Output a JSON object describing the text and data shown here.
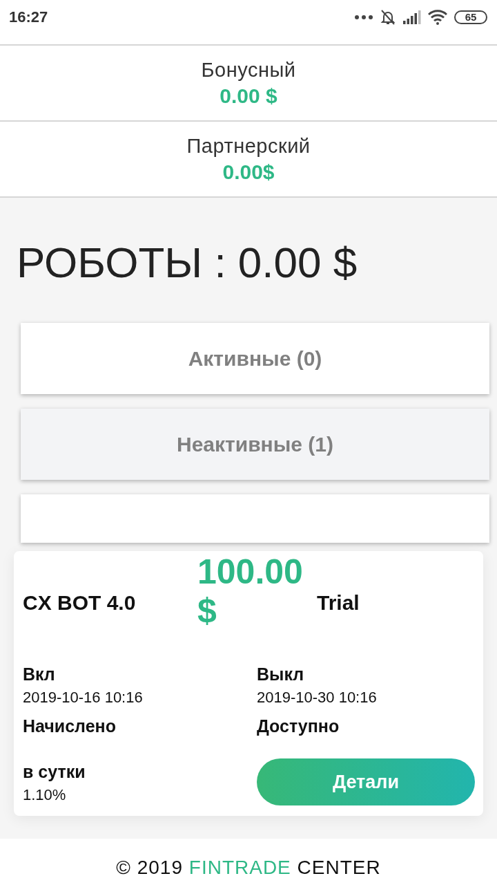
{
  "status_bar": {
    "time": "16:27",
    "battery": "65"
  },
  "balances": [
    {
      "label": "Бонусный",
      "amount": "0.00 $"
    },
    {
      "label": "Партнерский",
      "amount": "0.00$"
    }
  ],
  "robots": {
    "title": "РОБОТЫ : 0.00 $"
  },
  "tabs": [
    {
      "label": "Активные (0)",
      "selected": false
    },
    {
      "label": "Неактивные (1)",
      "selected": true
    }
  ],
  "bot_card": {
    "name": "CX BOT 4.0",
    "price": "100.00 $",
    "plan": "Trial",
    "fields": [
      {
        "label": "Вкл",
        "value": "2019-10-16 10:16"
      },
      {
        "label": "Выкл",
        "value": "2019-10-30 10:16"
      },
      {
        "label": "Начислено"
      },
      {
        "label": "Доступно"
      },
      {
        "label": "в сутки",
        "value": "1.10%"
      }
    ],
    "button": "Детали"
  },
  "footer": {
    "parts": [
      {
        "kind": "plain",
        "text": "© 2019 "
      },
      {
        "kind": "link",
        "text": "FINTRADE"
      },
      {
        "kind": "plain",
        "text": " CENTER"
      }
    ]
  }
}
